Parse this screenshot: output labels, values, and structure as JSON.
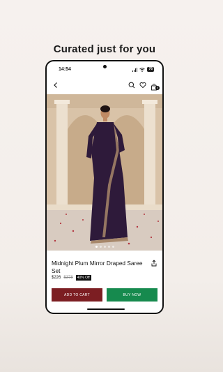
{
  "headline": "Curated just for you",
  "status": {
    "time": "14:54",
    "battery": "76"
  },
  "nav": {
    "back_icon": "chevron-left-icon",
    "search_icon": "search-icon",
    "wishlist_icon": "heart-icon",
    "cart_icon": "shopping-bag-icon",
    "cart_count": "0"
  },
  "product": {
    "name": "Midnight Plum Mirror Draped Saree Set",
    "price": "$226",
    "original_price": "$378",
    "discount": "40% Off",
    "image_count": 5,
    "active_image": 1
  },
  "actions": {
    "add_to_cart": "ADD TO CART",
    "buy_now": "BUY NOW",
    "share_icon": "share-icon"
  },
  "colors": {
    "add_to_cart": "#7c1e22",
    "buy_now": "#168a4e",
    "saree": "#2e1a3a"
  }
}
